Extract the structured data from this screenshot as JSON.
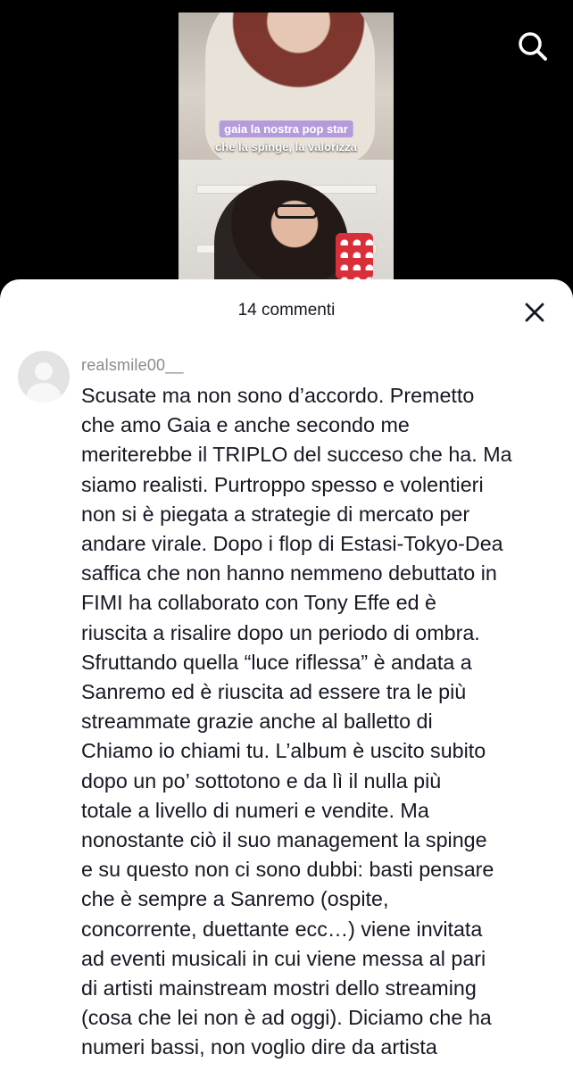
{
  "video": {
    "captions": [
      "gaia la nostra pop star",
      "che la spinge, la valorizza"
    ]
  },
  "top_bar": {
    "search_icon": "search-icon"
  },
  "comments_sheet": {
    "count_label": "14 commenti",
    "close_icon": "close-icon",
    "comments": [
      {
        "username": "realsmile00__",
        "text": "Scusate ma non sono d’accordo. Premetto\nche amo Gaia e anche secondo me\nmeriterebbe il TRIPLO del succeso che ha. Ma\nsiamo realisti. Purtroppo spesso e volentieri\nnon si è piegata a strategie di mercato per\nandare virale. Dopo i flop di Estasi-Tokyo-Dea\nsaffica che non hanno nemmeno debuttato in\nFIMI ha collaborato con Tony Effe ed è\nriuscita a risalire dopo un periodo di ombra.\nSfruttando quella “luce riflessa” è andata a\nSanremo ed è riuscita ad essere tra le più\nstreammate grazie anche al balletto di\nChiamo io chiami tu. L’album è uscito subito\ndopo un po’ sottotono e da lì il nulla più\ntotale a livello di numeri e vendite. Ma\nnonostante ciò il suo management la spinge\ne su questo non ci sono dubbi: basti pensare\nche è sempre a Sanremo (ospite,\nconcorrente, duettante ecc…) viene invitata\nad eventi musicali in cui viene messa al pari\ndi artisti mainstream mostri dello streaming\n(cosa che lei non è ad oggi). Diciamo che ha\nnumeri bassi, non voglio dire da artista"
      }
    ]
  }
}
